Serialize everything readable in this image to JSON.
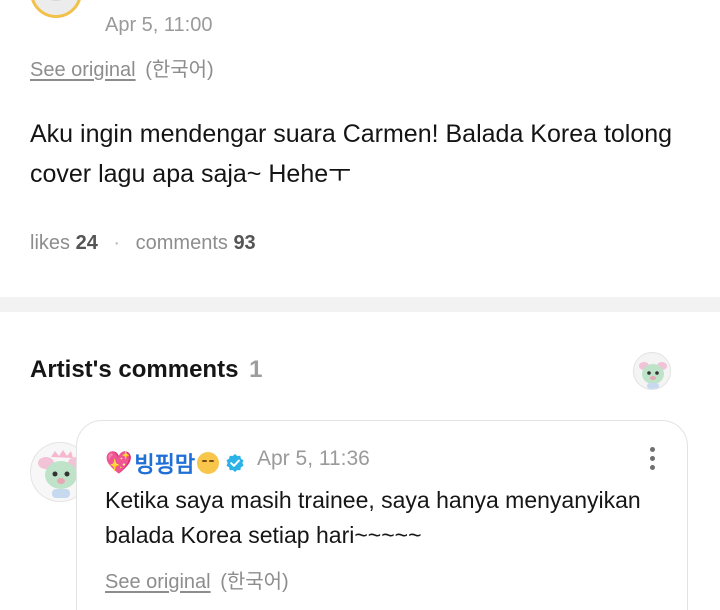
{
  "post": {
    "date": "Apr 5, 11:00",
    "see_original": "See original",
    "language": "(한국어)",
    "body": "Aku ingin mendengar suara Carmen! Balada Korea tolong cover lagu apa saja~ Heheㅜ",
    "likes_label": "likes",
    "likes_count": "24",
    "comments_label": "comments",
    "comments_count": "93",
    "stats_separator": "·"
  },
  "artist_comments": {
    "title": "Artist's comments",
    "count": "1",
    "comment": {
      "author": "빙핑맘",
      "date": "Apr 5, 11:36",
      "body": "Ketika saya masih trainee, saya hanya menyanyikan balada Korea setiap hari~~~~~",
      "see_original": "See original",
      "language": "(한국어)"
    }
  },
  "icons": {
    "author_prefix": "heart-icon",
    "author_suffix": "smirk-face-icon",
    "verified": "verified-badge-icon",
    "more": "more-vertical-icon"
  },
  "colors": {
    "accent_blue": "#1aa9f4",
    "author_name": "#1f6fd6",
    "verified": "#2bb3e8",
    "muted_text": "#8d8d8d"
  }
}
